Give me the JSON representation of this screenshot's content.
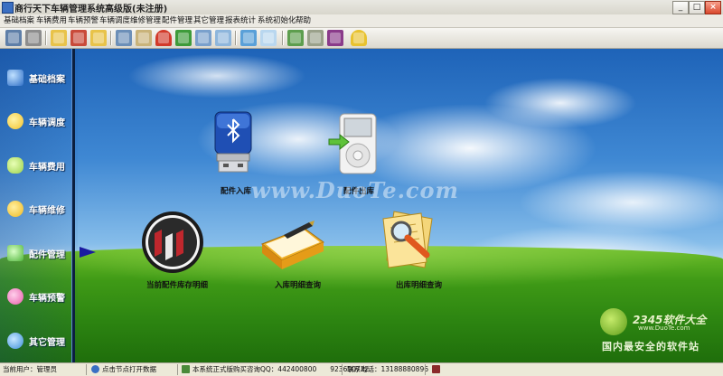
{
  "window": {
    "title": "商行天下车辆管理系统高级版(未注册)",
    "controls": {
      "minimize": "_",
      "maximize": "□",
      "close": "×"
    }
  },
  "menu": [
    "基础档案",
    "车辆费用",
    "车辆预警",
    "车辆调度",
    "维修管理",
    "配件管理",
    "其它管理",
    "报表统计",
    "系统初始化",
    "帮助"
  ],
  "toolbar": {
    "icons": [
      "monitor-icon",
      "printer-icon",
      "folder-icon",
      "color-folder-icon",
      "folder-icon",
      "notebook-icon",
      "pencil-doc-icon",
      "umbrella-icon",
      "green-book-icon",
      "magnifier-doc-icon",
      "broom-icon",
      "marker-icon",
      "paper-icon",
      "picture-icon",
      "calculator-icon",
      "book-icon",
      "running-man-icon"
    ]
  },
  "sidebar": {
    "items": [
      {
        "label": "基础档案",
        "icon": "folder-icon",
        "color": "#2f6fc7"
      },
      {
        "label": "车辆调度",
        "icon": "flower-icon",
        "color": "#f3c12a"
      },
      {
        "label": "车辆费用",
        "icon": "car-icon",
        "color": "#9bd24a"
      },
      {
        "label": "车辆维修",
        "icon": "flower-icon",
        "color": "#f0b81f"
      },
      {
        "label": "配件管理",
        "icon": "folder-icon",
        "color": "#4fb53b"
      },
      {
        "label": "车辆预警",
        "icon": "flower-icon",
        "color": "#e85aa8"
      },
      {
        "label": "其它管理",
        "icon": "globe-icon",
        "color": "#3b8fd8"
      }
    ],
    "active": "配件管理"
  },
  "modules": [
    {
      "label": "配件入库",
      "icon": "usb-drive-icon"
    },
    {
      "label": "配件出库",
      "icon": "ipod-icon"
    },
    {
      "label": "当前配件库存明细",
      "icon": "buick-logo-icon"
    },
    {
      "label": "入库明细查询",
      "icon": "notebook-pen-icon"
    },
    {
      "label": "出库明细查询",
      "icon": "search-documents-icon"
    }
  ],
  "watermarks": {
    "center": "www.DuoTe.com",
    "corner_title": "2345软件大全",
    "corner_url": "www.DuoTe.com",
    "corner_slogan": "国内最安全的软件站"
  },
  "statusbar": {
    "user": "当前用户：管理员",
    "hint": "点击节点打开数据",
    "purchase": "本系统正式版购买咨询QQ：442400800　　923690722",
    "phone": "联系电话：13188880896"
  }
}
